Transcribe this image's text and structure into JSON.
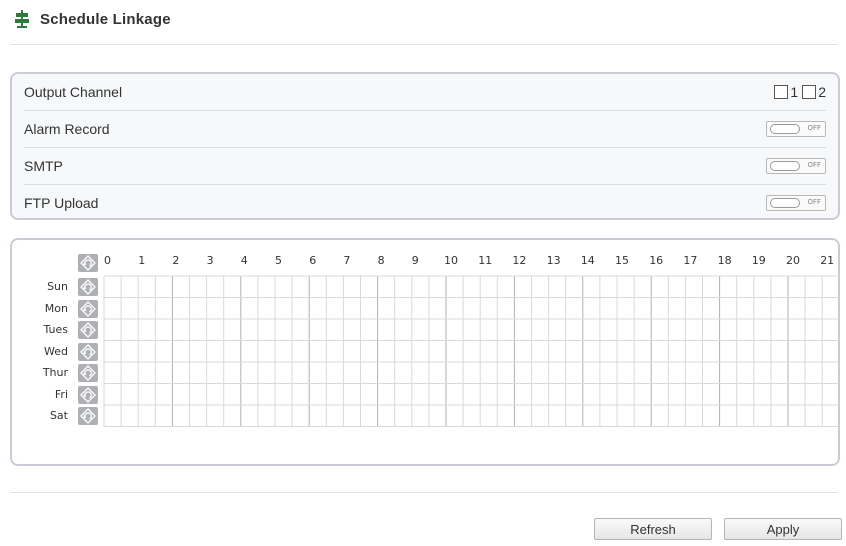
{
  "header": {
    "title": "Schedule Linkage",
    "icon": "signpost-icon"
  },
  "options": [
    {
      "label": "Output Channel",
      "type": "channels",
      "channels": [
        "1",
        "2"
      ]
    },
    {
      "label": "Alarm Record",
      "type": "toggle",
      "state": "OFF"
    },
    {
      "label": "SMTP",
      "type": "toggle",
      "state": "OFF"
    },
    {
      "label": "FTP Upload",
      "type": "toggle",
      "state": "OFF"
    }
  ],
  "schedule": {
    "hours": [
      "0",
      "1",
      "2",
      "3",
      "4",
      "5",
      "6",
      "7",
      "8",
      "9",
      "10",
      "11",
      "12",
      "13",
      "14",
      "15",
      "16",
      "17",
      "18",
      "19",
      "20",
      "21"
    ],
    "days": [
      "Sun",
      "Mon",
      "Tues",
      "Wed",
      "Thur",
      "Fri",
      "Sat"
    ],
    "cell_icon": "cycle-icon"
  },
  "buttons": {
    "refresh": "Refresh",
    "apply": "Apply"
  },
  "colors": {
    "panel_border": "#c9ccd6",
    "grid_line": "#d9d9d9",
    "grid_major": "#b0b0b0",
    "cycle_bg": "#aeb0b4"
  }
}
